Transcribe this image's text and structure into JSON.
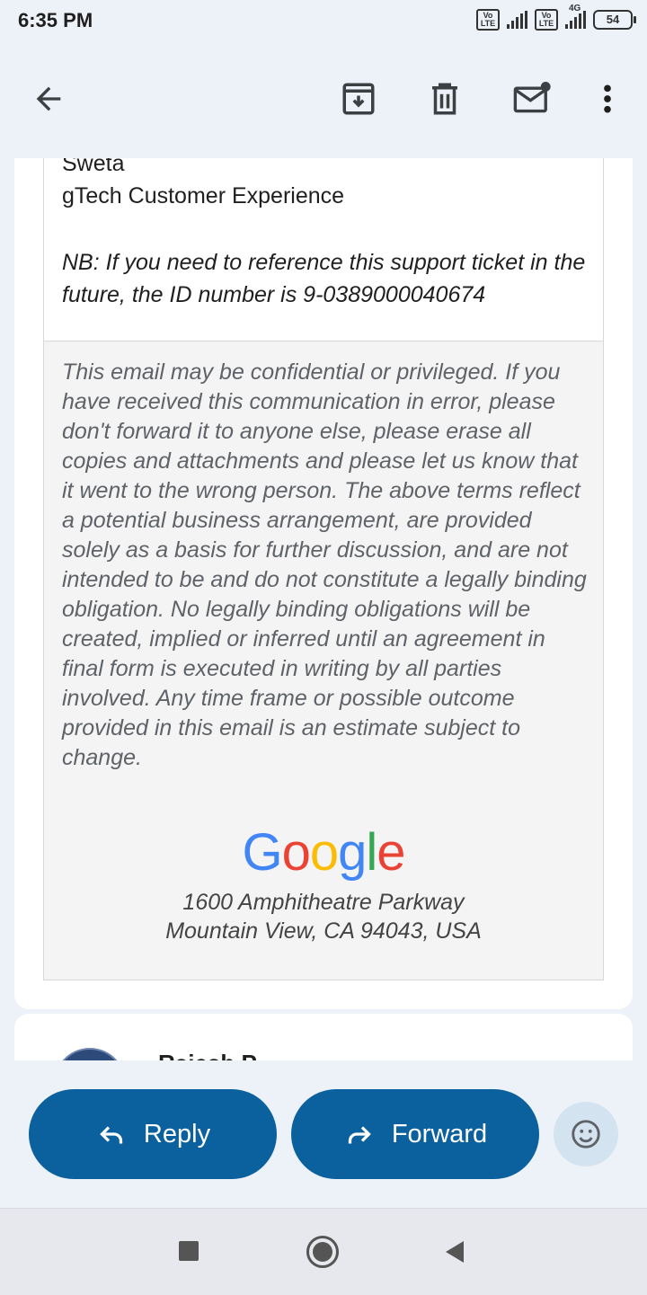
{
  "status_bar": {
    "time": "6:35 PM",
    "sim1_label": "Vo LTE",
    "sim2_label": "Vo LTE",
    "network": "4G",
    "battery": "54"
  },
  "toolbar": {
    "back_icon": "arrow-back-icon",
    "archive_icon": "archive-icon",
    "delete_icon": "trash-icon",
    "mark_unread_icon": "mail-unread-icon",
    "more_icon": "more-vert-icon"
  },
  "email": {
    "signature_name": "Sweta",
    "signature_team": "gTech Customer Experience",
    "nb_text": "NB: If you need to reference this support ticket in the future, the ID number is 9-0389000040674",
    "disclaimer": "This email may be confidential or privileged. If you have received this communication in error, please don't forward it to anyone else, please erase all copies and attachments and please let us know that it went to the wrong person. The above terms reflect a potential business arrangement, are provided solely as a basis for further discussion, and are not intended to be and do not constitute a legally binding obligation. No legally binding obligations will be created, implied or inferred until an agreement in final form is executed in writing by all parties involved. Any time frame or possible outcome provided in this email is an estimate subject to change.",
    "logo_text": "Google",
    "logo_colors": [
      "#4285F4",
      "#EA4335",
      "#FBBC05",
      "#4285F4",
      "#34A853",
      "#EA4335"
    ],
    "address_line1": "1600 Amphitheatre Parkway",
    "address_line2": "Mountain View, CA 94043, USA"
  },
  "next_message": {
    "sender_partial": "Rajesh P..."
  },
  "actions": {
    "reply_label": "Reply",
    "forward_label": "Forward",
    "reply_icon": "reply-icon",
    "forward_icon": "forward-icon",
    "emoji_icon": "emoji-reaction-icon",
    "accent": "#0b619e"
  },
  "nav": {
    "recents_icon": "square-recents-icon",
    "home_icon": "circle-home-icon",
    "back_icon": "triangle-back-icon"
  }
}
